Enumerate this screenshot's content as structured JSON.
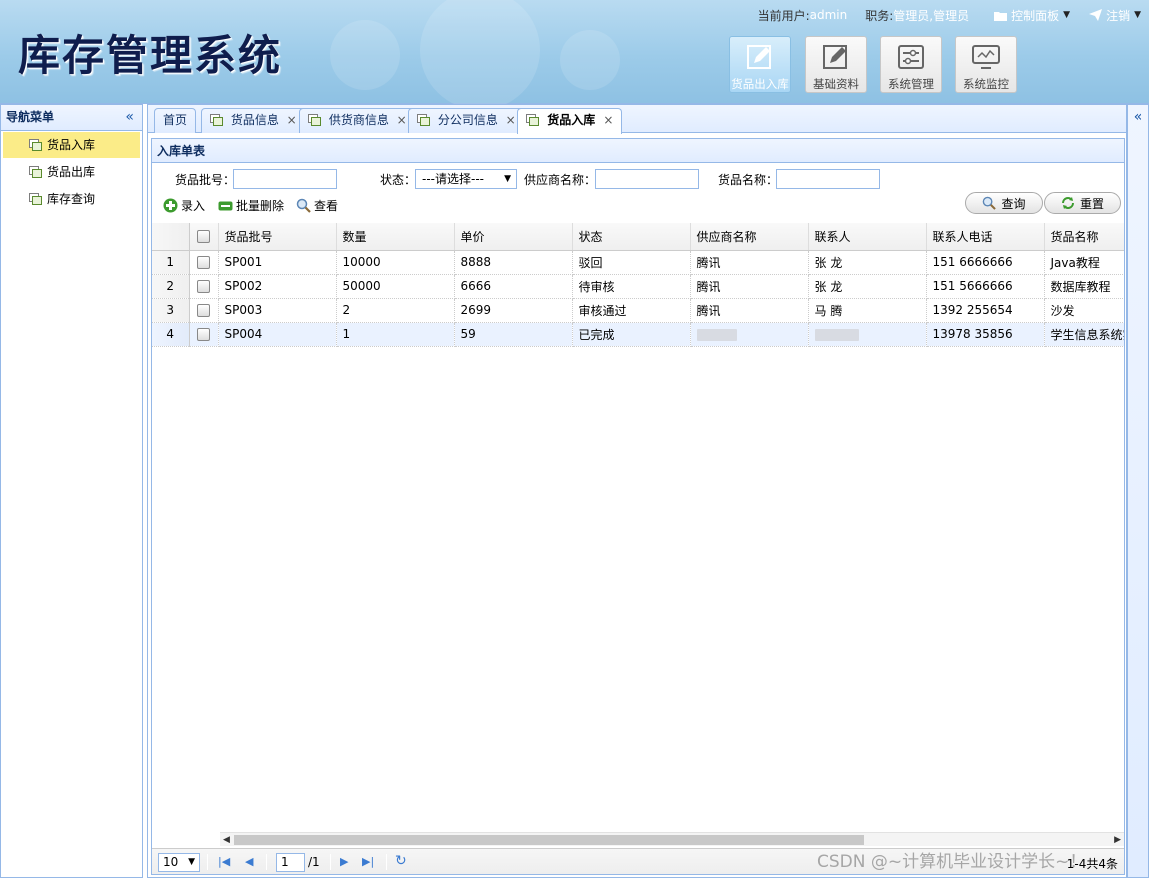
{
  "app": {
    "title": "库存管理系统"
  },
  "user_bar": {
    "current_user_label": "当前用户:",
    "current_user": "admin",
    "role_label": "职务:",
    "role": "管理员,管理员",
    "control_panel": "控制面板",
    "logout": "注销"
  },
  "modules": [
    {
      "label": "货品出入库",
      "icon": "edit-icon",
      "active": true
    },
    {
      "label": "基础资料",
      "icon": "edit-icon",
      "active": false
    },
    {
      "label": "系统管理",
      "icon": "sliders-icon",
      "active": false
    },
    {
      "label": "系统监控",
      "icon": "monitor-icon",
      "active": false
    }
  ],
  "west": {
    "title": "导航菜单",
    "items": [
      "货品入库",
      "货品出库",
      "库存查询"
    ]
  },
  "tabs": [
    "首页",
    "货品信息",
    "供货商信息",
    "分公司信息",
    "货品入库"
  ],
  "grid": {
    "title": "入库单表",
    "search": {
      "batch_label": "货品批号：",
      "status_label": "状态：",
      "status_value": "---请选择---",
      "supplier_label": "供应商名称：",
      "goods_label": "货品名称："
    },
    "tools": {
      "add": "录入",
      "batch_delete": "批量删除",
      "view": "查看"
    },
    "buttons": {
      "query": "查询",
      "reset": "重置"
    },
    "columns": [
      "货品批号",
      "数量",
      "单价",
      "状态",
      "供应商名称",
      "联系人",
      "联系人电话",
      "货品名称"
    ],
    "rows": [
      {
        "n": "1",
        "cells": [
          "SP001",
          "10000",
          "8888",
          "驳回",
          "腾讯",
          "张  龙",
          "151  6666666",
          "Java教程"
        ]
      },
      {
        "n": "2",
        "cells": [
          "SP002",
          "50000",
          "6666",
          "待审核",
          "腾讯",
          "张  龙",
          "151  5666666",
          "数据库教程"
        ]
      },
      {
        "n": "3",
        "cells": [
          "SP003",
          "2",
          "2699",
          "审核通过",
          "腾讯",
          "马  腾",
          "1392  255654",
          "沙发"
        ]
      },
      {
        "n": "4",
        "cells": [
          "SP004",
          "1",
          "59",
          "已完成",
          "",
          "",
          "13978  35856",
          "学生信息系统实"
        ]
      }
    ]
  },
  "pager": {
    "page_size": "10",
    "page": "1",
    "total_pages": "/1",
    "info": "1-4共4条"
  },
  "watermark": "CSDN @~计算机毕业设计学长~！"
}
